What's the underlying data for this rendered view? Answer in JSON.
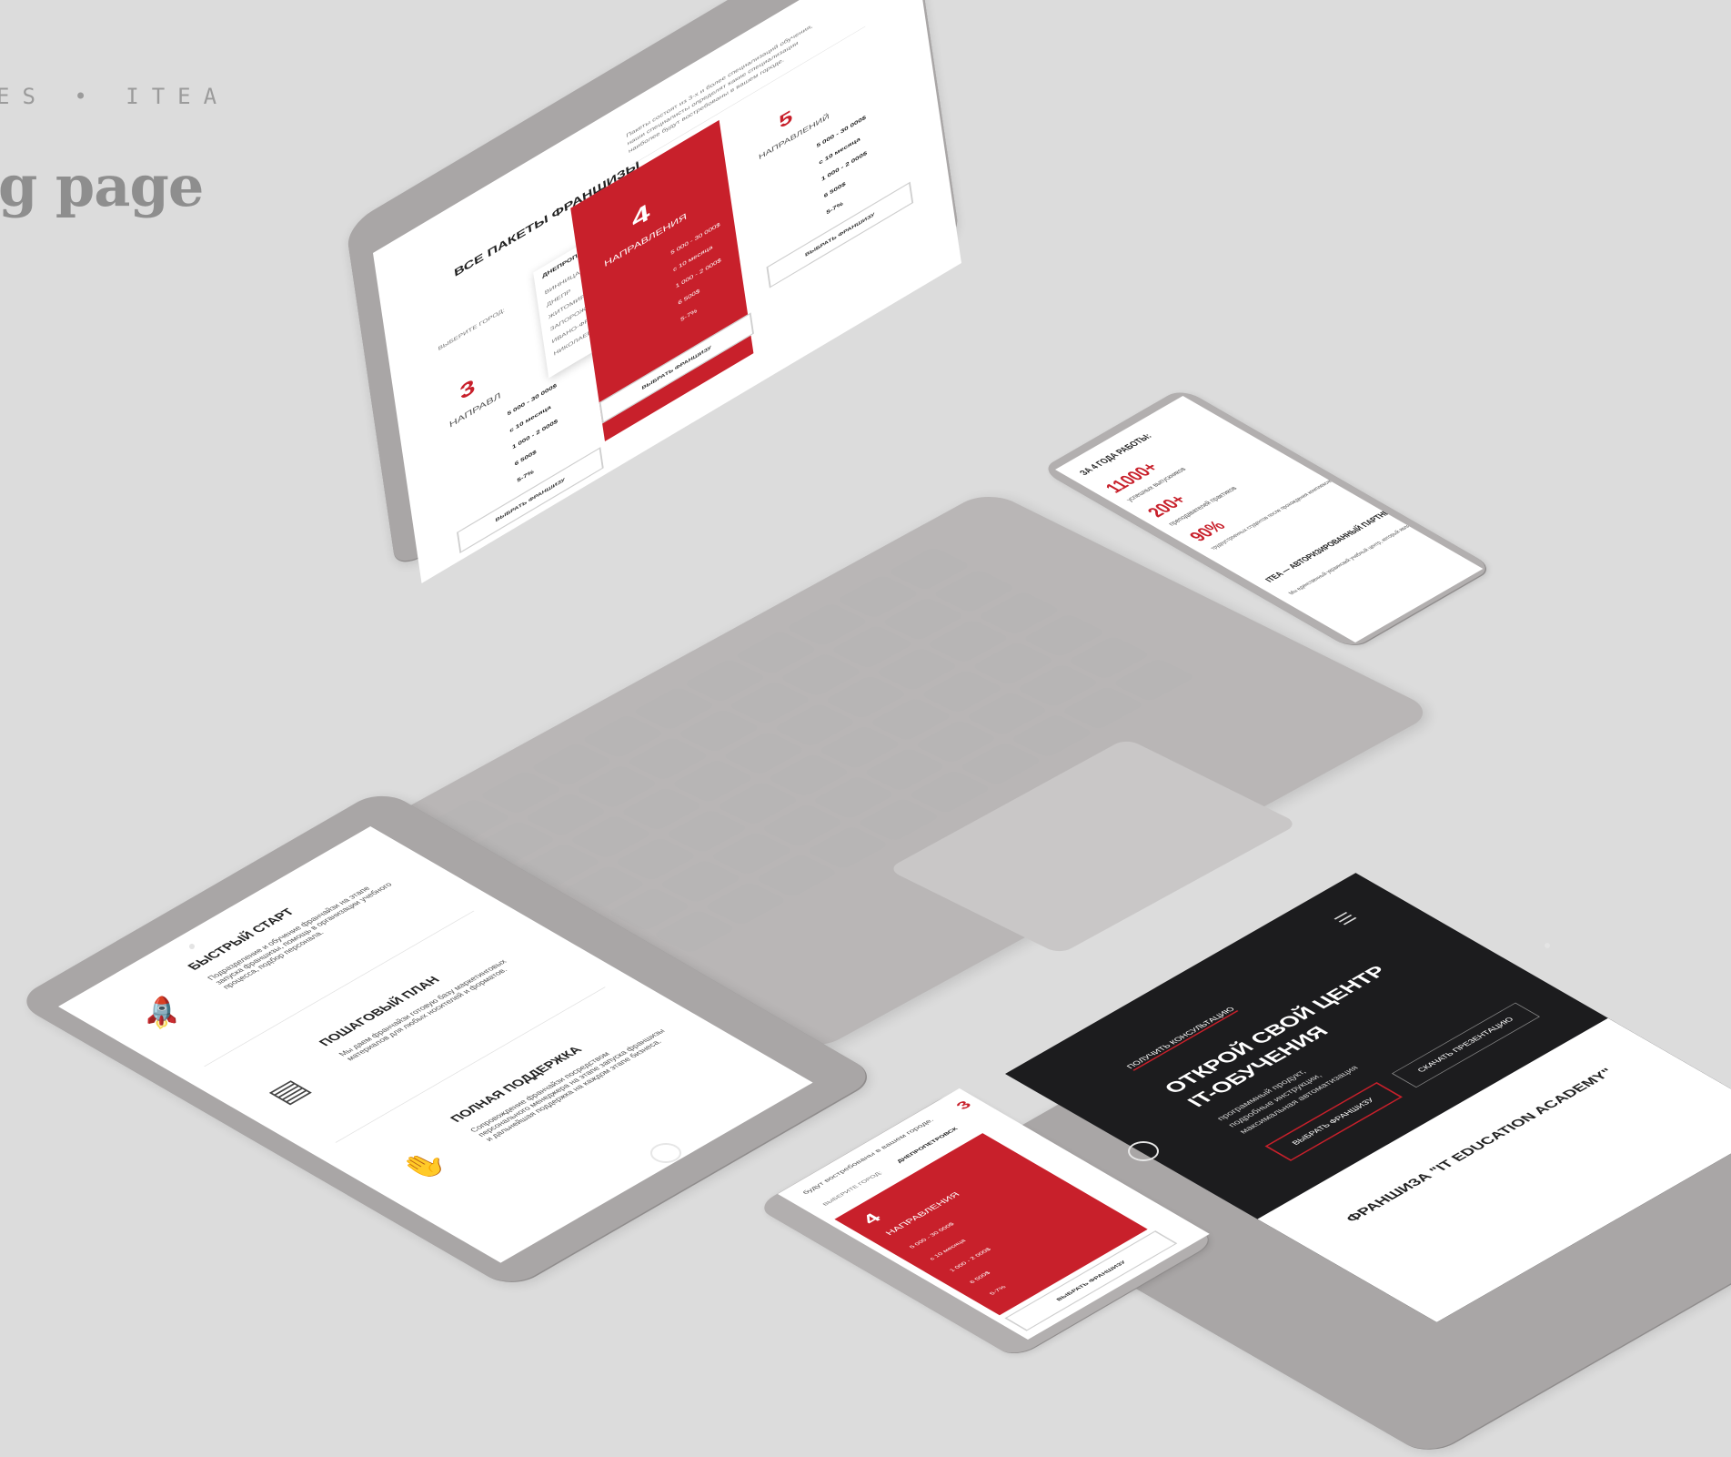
{
  "header": {
    "kicker": "ES • ITEA",
    "title": "g page"
  },
  "laptop": {
    "section_title": "ВСЕ ПАКЕТЫ ФРАНШИЗЫ",
    "intro": [
      "Пакеты состоят из 3-х и более специализаций обучения,",
      "наши специалисты определят какие специализации",
      "наиболее будут востребованы в вашем городе."
    ],
    "city_label": "ВЫБЕРИТЕ ГОРОД:",
    "city_selected": "ДНЕПРОПЕТРОВСК",
    "cities": [
      "ВИННИЦА",
      "ДНЕПР",
      "ЖИТОМИР",
      "ЗАПОРОЖЬЕ",
      "ИВАНО-ФРАНКОВСК",
      "НИКОЛАЕВ"
    ],
    "packages": [
      {
        "number": "3",
        "label": "НАПРАВЛ",
        "rows": [
          "5 000 - 30 000$",
          "с 10 месяца",
          "1 000 - 2 000$",
          "6 500$",
          "5-7%"
        ],
        "button": "ВЫБРАТЬ ФРАНШИЗУ"
      },
      {
        "number": "4",
        "label": "НАПРАВЛЕНИЯ",
        "rows": [
          "5 000 - 30 000$",
          "с 10 месяца",
          "1 000 - 2 000$",
          "6 500$",
          "5-7%"
        ],
        "button": "ВЫБРАТЬ ФРАНШИЗУ"
      },
      {
        "number": "5",
        "label": "НАПРАВЛЕНИЙ",
        "rows": [
          "5 000 - 30 000$",
          "с 10 месяца",
          "1 000 - 2 000$",
          "6 500$",
          "5-7%"
        ],
        "button": "ВЫБРАТЬ ФРАНШИЗУ"
      }
    ]
  },
  "phone_right": {
    "title": "ЗА 4 ГОДА РАБОТЫ:",
    "stats": [
      {
        "value": "11000+",
        "text": "успешных выпускников"
      },
      {
        "value": "200+",
        "text": "преподавателей практиков"
      },
      {
        "value": "90%",
        "text": "трудоустроенных студентов после прохождения комплексного обучения"
      }
    ],
    "partner_title": "ITEA — АВТОРИЗИРОВАННЫЙ ПАРТНЕР",
    "partner_text": "Мы единственный украинский учебный центр, который является официальным"
  },
  "tablet_left": {
    "items": [
      {
        "title": "БЫСТРЫЙ СТАРТ",
        "icon": "rocket-icon",
        "text": "Подразделение и обучение франчайзи на этапе запуска франшизы, помощь в организации учебного процесса, подбор персонала."
      },
      {
        "title": "ПОШАГОВЫЙ ПЛАН",
        "icon": "plan-icon",
        "text": "Мы даем франчайзи готовую базу маркетинговых материалов для любых носителей и форматов."
      },
      {
        "title": "ПОЛНАЯ ПОДДЕРЖКА",
        "icon": "support-icon",
        "text": "Сопровождение франчайзи посредством персонального менеджера на этапе запуска франшизы и дальнейшая поддержка на каждом этапе бизнеса."
      }
    ]
  },
  "tablet_right": {
    "top_link": "ПОЛУЧИТЬ КОНСУЛЬТАЦИЮ",
    "hero_title": [
      "ОТКРОЙ СВОЙ ЦЕНТР",
      "IT-ОБУЧЕНИЯ"
    ],
    "hero_text": [
      "программный продукт,",
      "подробные инструкции,",
      "максимальная автоматизация"
    ],
    "cta": "ВЫБРАТЬ ФРАНШИЗУ",
    "download": "СКАЧАТЬ ПРЕЗЕНТАЦИЮ",
    "footer": "ФРАНШИЗА \"IT EDUCATION ACADEMY\""
  },
  "phone_bottom": {
    "intro": "будут востребованы в вашем городе.",
    "city_label": "ВЫБЕРИТЕ ГОРОД:",
    "city_selected": "ДНЕПРОПЕТРОВСК",
    "number": "4",
    "label": "НАПРАВЛЕНИЯ",
    "rows": [
      "5 000 - 30 000$",
      "с 10 месяца",
      "1 000 - 2 000$",
      "6 500$",
      "5-7%"
    ],
    "button": "ВЫБРАТЬ ФРАНШИЗУ",
    "side_number": "3"
  },
  "colors": {
    "accent": "#c8202b",
    "background": "#dcdcdc",
    "device": "#a9a6a6"
  }
}
